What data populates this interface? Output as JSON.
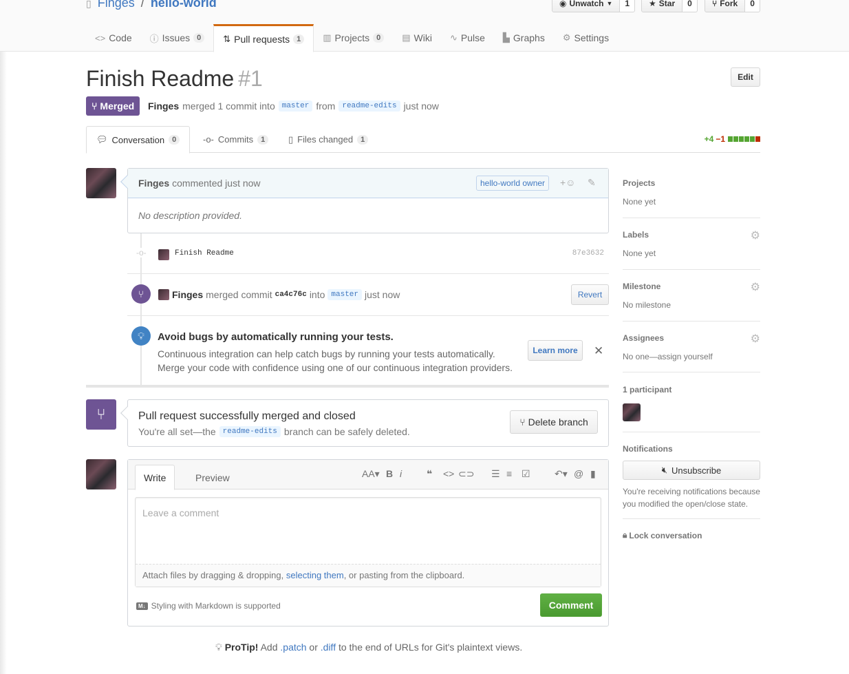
{
  "repo": {
    "owner": "Finges",
    "separator": "/",
    "name": "hello-world"
  },
  "actions": [
    {
      "label": "Unwatch",
      "icon": "eye-icon",
      "count": "1"
    },
    {
      "label": "Star",
      "icon": "star-icon",
      "count": "0"
    },
    {
      "label": "Fork",
      "icon": "fork-icon",
      "count": "0"
    }
  ],
  "reponav": {
    "code": "Code",
    "issues": "Issues",
    "issues_count": "0",
    "pulls": "Pull requests",
    "pulls_count": "1",
    "projects": "Projects",
    "projects_count": "0",
    "wiki": "Wiki",
    "pulse": "Pulse",
    "graphs": "Graphs",
    "settings": "Settings"
  },
  "pr": {
    "title": "Finish Readme",
    "number": "#1",
    "edit_label": "Edit",
    "state": "Merged",
    "author": "Finges",
    "merge_text": "merged 1 commit into",
    "base_branch": "master",
    "from_text": "from",
    "head_branch": "readme-edits",
    "time": "just now"
  },
  "tabs": {
    "conversation": "Conversation",
    "conversation_count": "0",
    "commits": "Commits",
    "commits_count": "1",
    "files": "Files changed",
    "files_count": "1"
  },
  "diffstat": {
    "additions": "+4",
    "deletions": "−1",
    "blocks": [
      "#55a532",
      "#55a532",
      "#55a532",
      "#55a532",
      "#55a532",
      "#bd2c00"
    ]
  },
  "comment": {
    "author": "Finges",
    "action": "commented",
    "time": "just now",
    "owner_label": "hello-world owner",
    "body": "No description provided."
  },
  "commit": {
    "message": "Finish Readme",
    "sha": "87e3632"
  },
  "merge_event": {
    "author": "Finges",
    "text": "merged commit",
    "sha": "ca4c76c",
    "into": "into",
    "branch": "master",
    "time": "just now",
    "revert_label": "Revert"
  },
  "ci": {
    "title": "Avoid bugs by automatically running your tests.",
    "line1": "Continuous integration can help catch bugs by running your tests automatically.",
    "line2": "Merge your code with confidence using one of our continuous integration providers.",
    "learn_more": "Learn more"
  },
  "merge_status": {
    "title": "Pull request successfully merged and closed",
    "text_before": "You're all set—the",
    "branch": "readme-edits",
    "text_after": "branch can be safely deleted.",
    "delete_label": "Delete branch"
  },
  "new_comment": {
    "write_tab": "Write",
    "preview_tab": "Preview",
    "placeholder": "Leave a comment",
    "attach_before": "Attach files by dragging & dropping,",
    "attach_link": "selecting them",
    "attach_after": ", or pasting from the clipboard.",
    "markdown_note": "Styling with Markdown is supported",
    "submit_label": "Comment"
  },
  "protip": {
    "label": "ProTip!",
    "text1": "Add",
    "patch": ".patch",
    "or": "or",
    "diff": ".diff",
    "text2": "to the end of URLs for Git's plaintext views."
  },
  "sidebar": {
    "projects_title": "Projects",
    "projects_value": "None yet",
    "labels_title": "Labels",
    "labels_value": "None yet",
    "milestone_title": "Milestone",
    "milestone_value": "No milestone",
    "assignees_title": "Assignees",
    "assignees_value": "No one—assign yourself",
    "participants_title": "1 participant",
    "notifications_title": "Notifications",
    "unsubscribe_label": "Unsubscribe",
    "notif_reason": "You're receiving notifications because you modified the open/close state.",
    "lock_label": "Lock conversation"
  }
}
